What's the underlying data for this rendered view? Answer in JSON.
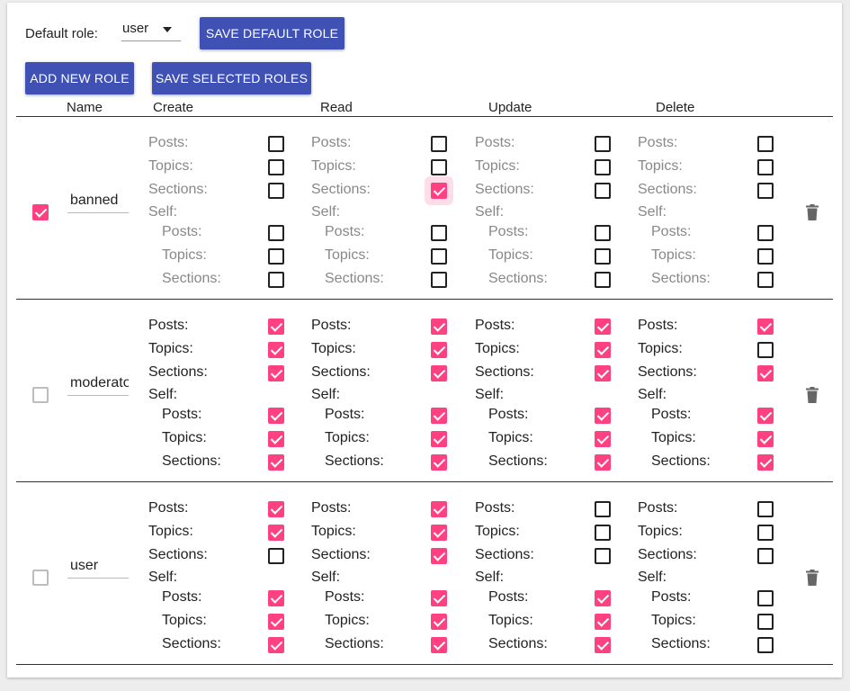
{
  "toolbar": {
    "default_role_label": "Default role:",
    "default_role_value": "user",
    "save_default_label": "SAVE DEFAULT ROLE",
    "add_new_role_label": "ADD NEW ROLE",
    "save_selected_label": "SAVE SELECTED ROLES"
  },
  "columns": [
    "Name",
    "Create",
    "Read",
    "Update",
    "Delete"
  ],
  "perm_labels": {
    "posts": "Posts:",
    "topics": "Topics:",
    "sections": "Sections:",
    "self": "Self:"
  },
  "colors": {
    "accent": "#ff4081",
    "primary": "#3f51b5"
  },
  "roles": [
    {
      "name": "banned",
      "selected": true,
      "muted": true,
      "perms": {
        "create": {
          "posts": false,
          "topics": false,
          "sections": false,
          "self_posts": false,
          "self_topics": false,
          "self_sections": false
        },
        "read": {
          "posts": false,
          "topics": false,
          "sections": true,
          "self_posts": false,
          "self_topics": false,
          "self_sections": false
        },
        "update": {
          "posts": false,
          "topics": false,
          "sections": false,
          "self_posts": false,
          "self_topics": false,
          "self_sections": false
        },
        "delete": {
          "posts": false,
          "topics": false,
          "sections": false,
          "self_posts": false,
          "self_topics": false,
          "self_sections": false
        }
      }
    },
    {
      "name": "moderator",
      "selected": false,
      "muted": false,
      "perms": {
        "create": {
          "posts": true,
          "topics": true,
          "sections": true,
          "self_posts": true,
          "self_topics": true,
          "self_sections": true
        },
        "read": {
          "posts": true,
          "topics": true,
          "sections": true,
          "self_posts": true,
          "self_topics": true,
          "self_sections": true
        },
        "update": {
          "posts": true,
          "topics": true,
          "sections": true,
          "self_posts": true,
          "self_topics": true,
          "self_sections": true
        },
        "delete": {
          "posts": true,
          "topics": false,
          "sections": true,
          "self_posts": true,
          "self_topics": true,
          "self_sections": true
        }
      }
    },
    {
      "name": "user",
      "selected": false,
      "muted": false,
      "perms": {
        "create": {
          "posts": true,
          "topics": true,
          "sections": false,
          "self_posts": true,
          "self_topics": true,
          "self_sections": true
        },
        "read": {
          "posts": true,
          "topics": true,
          "sections": true,
          "self_posts": true,
          "self_topics": true,
          "self_sections": true
        },
        "update": {
          "posts": false,
          "topics": false,
          "sections": false,
          "self_posts": true,
          "self_topics": true,
          "self_sections": true
        },
        "delete": {
          "posts": false,
          "topics": false,
          "sections": false,
          "self_posts": false,
          "self_topics": false,
          "self_sections": false
        }
      }
    }
  ]
}
